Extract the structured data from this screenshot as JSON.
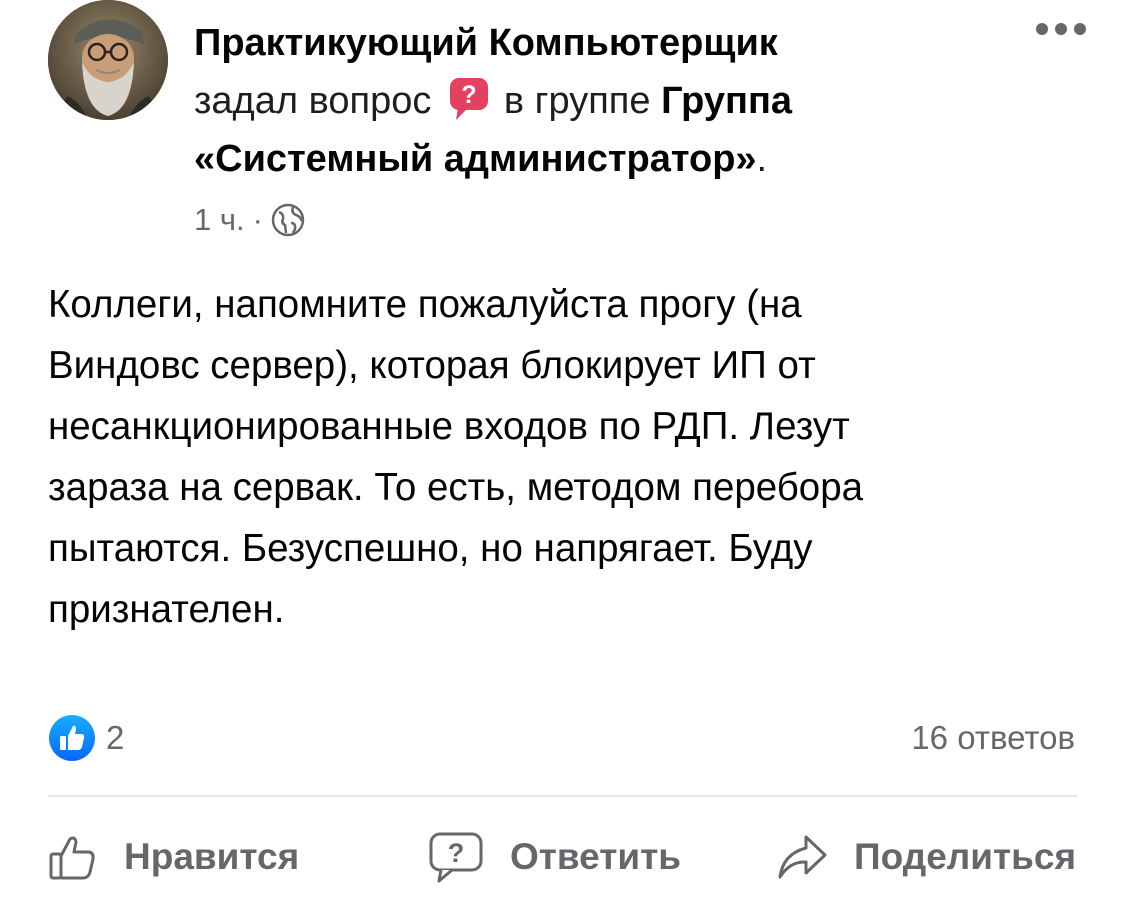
{
  "post": {
    "author": "Практикующий Компьютерщик",
    "action_text": "задал вопрос",
    "group_prefix": "в группе",
    "group_name": "Группа «Системный администратор»",
    "group_suffix": ".",
    "time": "1 ч.",
    "separator": "·",
    "visibility_icon": "globe-icon",
    "body": "Коллеги, напомните пожалуйста прогу (на\nВиндовс сервер), которая блокирует ИП от\nнесанкционированные входов по РДП. Лезут\nзараза на сервак. То есть, методом перебора\nпытаются. Безуспешно, но напрягает. Буду\nпризнателен."
  },
  "reactions": {
    "icon": "like-icon",
    "count": "2"
  },
  "answers": {
    "label": "16 ответов"
  },
  "actions": {
    "like_label": "Нравится",
    "answer_label": "Ответить",
    "share_label": "Поделиться"
  },
  "colors": {
    "accent_blue": "#1877f2",
    "question_badge": "#e4405f",
    "secondary_text": "#65676b"
  }
}
